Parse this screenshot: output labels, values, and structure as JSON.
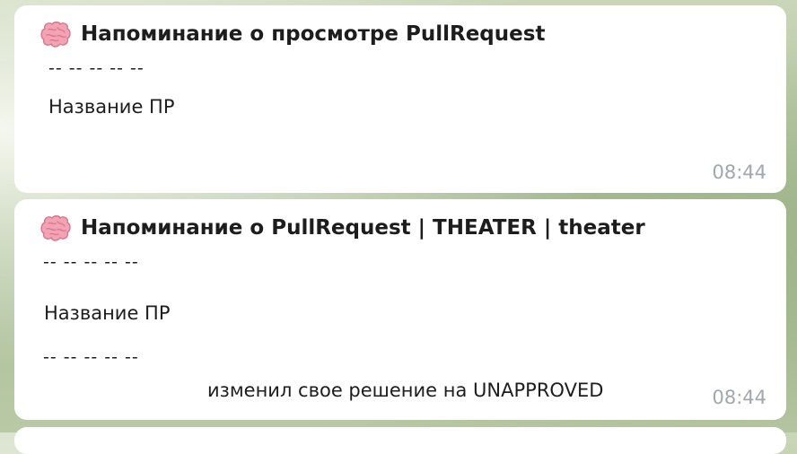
{
  "messages": [
    {
      "icon": "brain-icon",
      "title": "Напоминание о просмотре PullRequest",
      "separator": "-- -- -- -- --",
      "pr_name": "Название ПР",
      "time": "08:44"
    },
    {
      "icon": "brain-icon",
      "title": "Напоминание о PullRequest | THEATER | theater",
      "separator_1": "-- -- -- -- --",
      "pr_name": "Название ПР",
      "separator_2": "-- -- -- -- --",
      "status": "изменил свое решение на UNAPPROVED",
      "time": "08:44"
    }
  ],
  "colors": {
    "bubble": "#ffffff",
    "text": "#1d1d1d",
    "timestamp": "#a0a7ad",
    "brain_pink": "#f2a3b4"
  }
}
